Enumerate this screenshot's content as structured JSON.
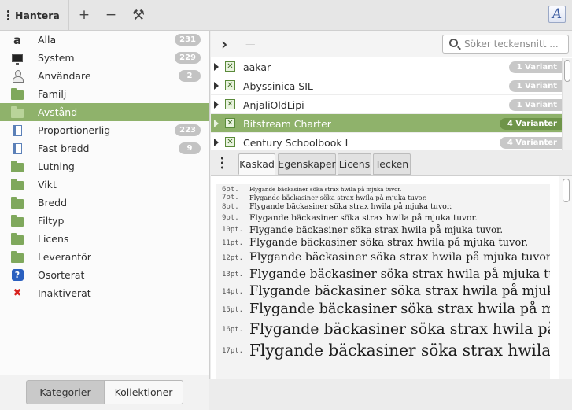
{
  "header": {
    "title": "Hantera",
    "add_label": "+",
    "remove_label": "−",
    "tools_label": "⚒",
    "font_icon_label": "A"
  },
  "sidebar": {
    "items": [
      {
        "label": "Alla",
        "count": "231",
        "icon": "a-icon"
      },
      {
        "label": "System",
        "count": "229",
        "icon": "monitor-icon"
      },
      {
        "label": "Användare",
        "count": "2",
        "icon": "user-icon"
      },
      {
        "label": "Familj",
        "count": "",
        "icon": "folder-icon"
      },
      {
        "label": "Avstånd",
        "count": "",
        "icon": "folder-icon",
        "selected": true
      },
      {
        "label": "Proportionerlig",
        "count": "223",
        "icon": "book-icon"
      },
      {
        "label": "Fast bredd",
        "count": "9",
        "icon": "book-icon"
      },
      {
        "label": "Lutning",
        "count": "",
        "icon": "folder-icon"
      },
      {
        "label": "Vikt",
        "count": "",
        "icon": "folder-icon"
      },
      {
        "label": "Bredd",
        "count": "",
        "icon": "folder-icon"
      },
      {
        "label": "Filtyp",
        "count": "",
        "icon": "folder-icon"
      },
      {
        "label": "Licens",
        "count": "",
        "icon": "folder-icon"
      },
      {
        "label": "Leverantör",
        "count": "",
        "icon": "folder-icon"
      },
      {
        "label": "Osorterat",
        "count": "",
        "icon": "question-icon"
      },
      {
        "label": "Inaktiverat",
        "count": "",
        "icon": "x-icon"
      }
    ],
    "bottom": {
      "categories_label": "Kategorier",
      "collections_label": "Kollektioner"
    }
  },
  "fontlist": {
    "nav_label": "›",
    "path_label": "—",
    "search_placeholder": "Söker teckensnitt ...",
    "rows": [
      {
        "name": "aakar",
        "variants": "1 Variant"
      },
      {
        "name": "Abyssinica SIL",
        "variants": "1 Variant"
      },
      {
        "name": "AnjaliOldLipi",
        "variants": "1 Variant"
      },
      {
        "name": "Bitstream Charter",
        "variants": "4 Varianter",
        "selected": true
      },
      {
        "name": "Century Schoolbook L",
        "variants": "4 Varianter"
      }
    ]
  },
  "tabs": [
    "Kaskad",
    "Egenskaper",
    "Licens",
    "Tecken"
  ],
  "preview": {
    "sample": "Flygande bäckasiner söka strax hwila på mjuka tuvor.",
    "lines": [
      {
        "pt": "6pt."
      },
      {
        "pt": "7pt."
      },
      {
        "pt": "8pt."
      },
      {
        "pt": "9pt."
      },
      {
        "pt": "10pt."
      },
      {
        "pt": "11pt."
      },
      {
        "pt": "12pt."
      },
      {
        "pt": "13pt."
      },
      {
        "pt": "14pt."
      },
      {
        "pt": "15pt."
      },
      {
        "pt": "16pt."
      },
      {
        "pt": "17pt."
      }
    ]
  }
}
